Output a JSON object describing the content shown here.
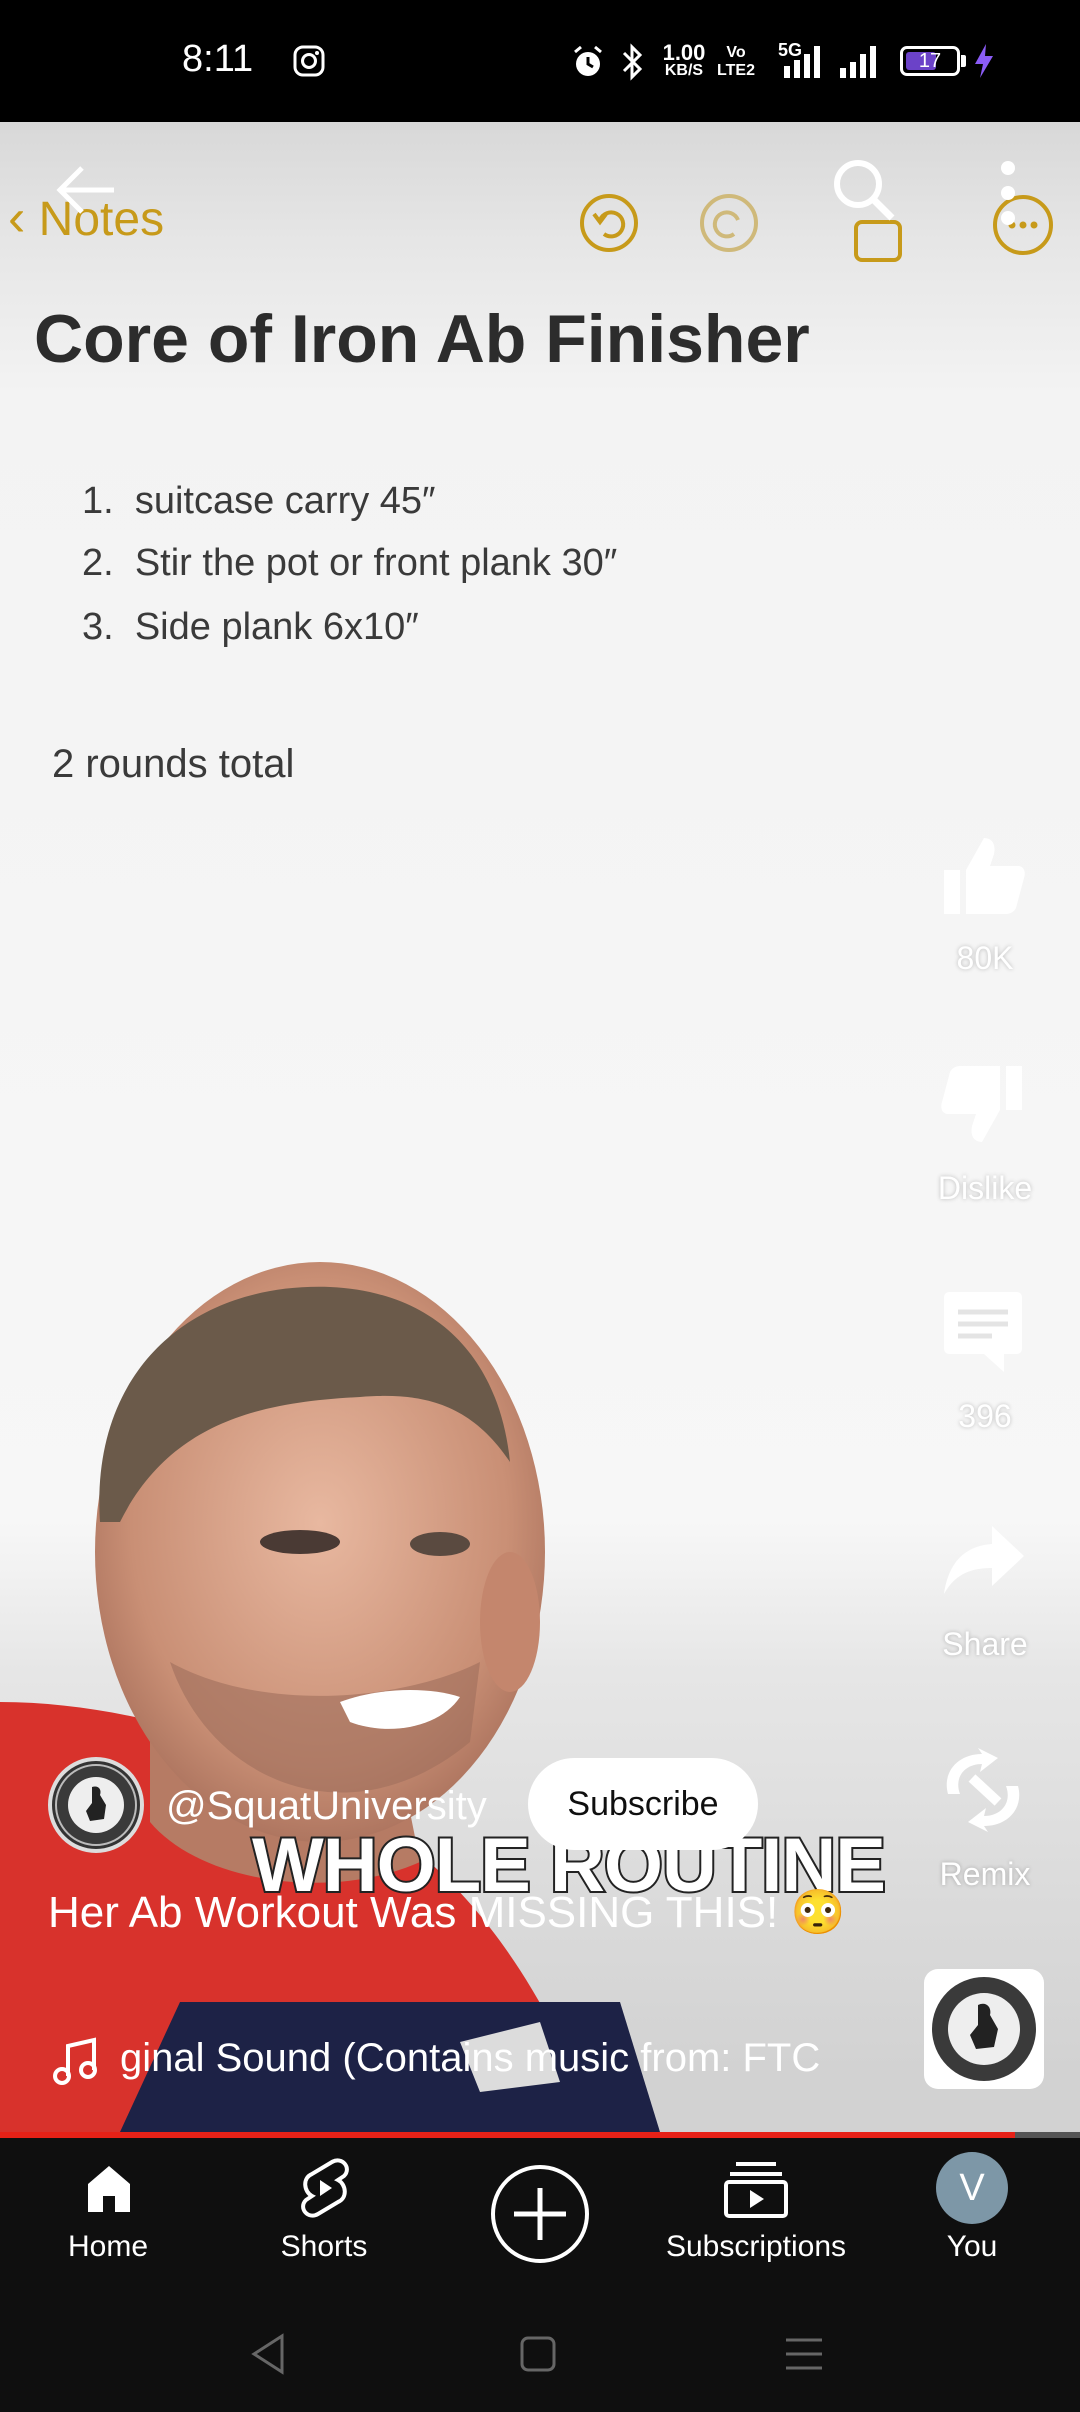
{
  "status_bar": {
    "time": "8:11",
    "speed_value": "1.00",
    "speed_unit": "KB/S",
    "volte_label": "Vo LTE2",
    "network": "5G",
    "battery": "17"
  },
  "note": {
    "back_label": "Notes",
    "title": "Core of Iron Ab Finisher",
    "items": [
      {
        "num": "1.",
        "text": "suitcase carry 45″"
      },
      {
        "num": "2.",
        "text": "Stir the pot or front plank 30″"
      },
      {
        "num": "3.",
        "text": "Side plank 6x10″"
      }
    ],
    "footer": "2 rounds total"
  },
  "video_caption": "WHOLE ROUTINE",
  "actions": {
    "likes": "80K",
    "dislike": "Dislike",
    "comments": "396",
    "share": "Share",
    "remix": "Remix"
  },
  "channel": {
    "handle": "@SquatUniversity",
    "subscribe_label": "Subscribe"
  },
  "video_title": "Her Ab Workout Was MISSING THIS! 😳",
  "sound": "ɡinal Sound (Contains music from: FTC",
  "progress": 0.94,
  "nav": {
    "home": "Home",
    "shorts": "Shorts",
    "subscriptions": "Subscriptions",
    "you": "You",
    "you_initial": "V"
  },
  "colors": {
    "accent_red": "#e62117",
    "nav_bg": "#0f0f0f",
    "notes_yellow": "#c79a1a"
  }
}
